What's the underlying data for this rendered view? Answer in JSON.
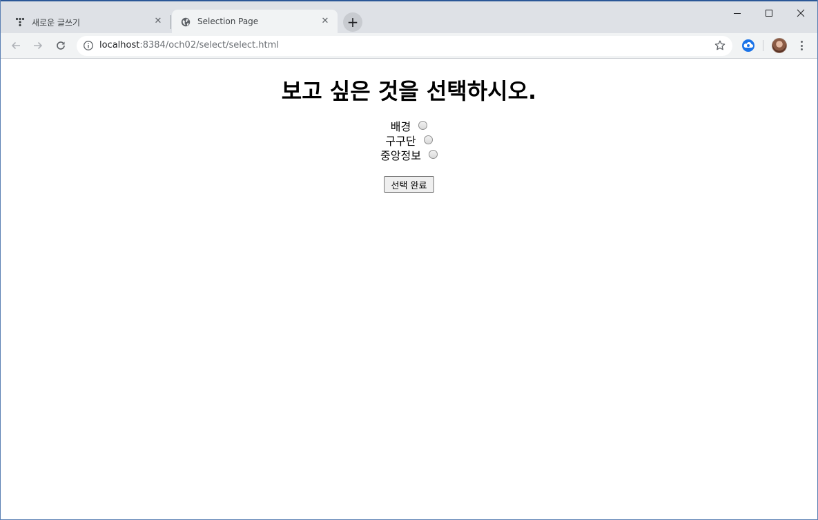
{
  "browser": {
    "tabs": [
      {
        "title": "새로운 글쓰기",
        "close": "✕",
        "favicon": "tistory-icon",
        "active": false
      },
      {
        "title": "Selection Page",
        "close": "✕",
        "favicon": "globe-icon",
        "active": true
      }
    ],
    "new_tab": "+",
    "address": {
      "host": "localhost",
      "rest": ":8384/och02/select/select.html"
    },
    "icons": {
      "back": "arrow-left-icon",
      "forward": "arrow-right-icon",
      "reload": "reload-icon",
      "info": "info-icon",
      "bookmark": "star-icon",
      "extension": "cloud-extension-icon",
      "profile": "avatar",
      "menu": "kebab-menu-icon",
      "minimize": "minimize-icon",
      "maximize": "maximize-icon",
      "close": "close-icon"
    },
    "colors": {
      "tabstrip": "#dee1e6",
      "toolbar": "#f1f3f4",
      "active_tab": "#f1f3f4"
    }
  },
  "page": {
    "title": "보고 싶은 것을 선택하시오.",
    "options": [
      {
        "label": "배경",
        "checked": false
      },
      {
        "label": "구구단",
        "checked": false
      },
      {
        "label": "중앙정보",
        "checked": false
      }
    ],
    "submit_label": "선택 완료"
  }
}
